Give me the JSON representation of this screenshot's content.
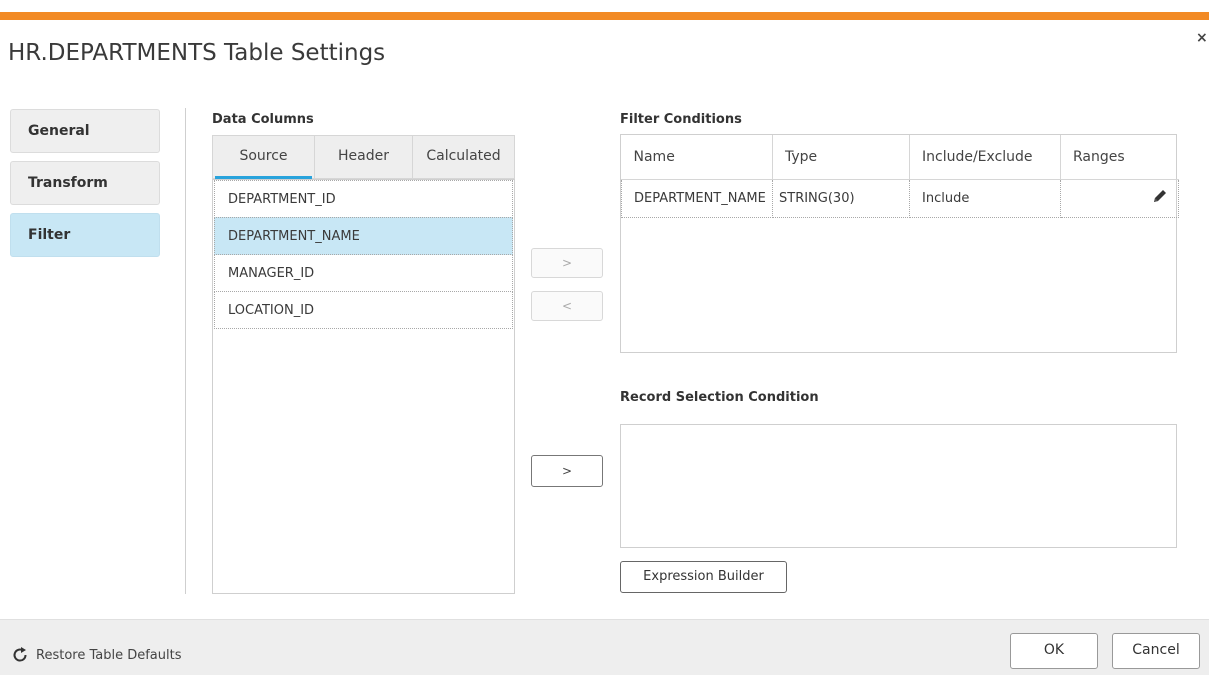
{
  "dialog": {
    "title": "HR.DEPARTMENTS Table Settings",
    "close_label": "×"
  },
  "colors": {
    "accent": "#f28a25",
    "selected": "#c8e7f5",
    "tab_underline": "#29a3dc"
  },
  "nav": {
    "items": [
      {
        "label": "General",
        "active": false
      },
      {
        "label": "Transform",
        "active": false
      },
      {
        "label": "Filter",
        "active": true
      }
    ]
  },
  "data_columns": {
    "title": "Data Columns",
    "tabs": [
      {
        "label": "Source",
        "active": true
      },
      {
        "label": "Header",
        "active": false
      },
      {
        "label": "Calculated",
        "active": false
      }
    ],
    "rows": [
      {
        "label": "DEPARTMENT_ID",
        "selected": false
      },
      {
        "label": "DEPARTMENT_NAME",
        "selected": true
      },
      {
        "label": "MANAGER_ID",
        "selected": false
      },
      {
        "label": "LOCATION_ID",
        "selected": false
      }
    ]
  },
  "transfer": {
    "add_label": ">",
    "remove_label": "<",
    "add_condition_label": ">"
  },
  "filter_conditions": {
    "title": "Filter Conditions",
    "headers": [
      "Name",
      "Type",
      "Include/Exclude",
      "Ranges"
    ],
    "rows": [
      {
        "name": "DEPARTMENT_NAME",
        "type": "STRING(30)",
        "include_exclude": "Include",
        "ranges": "",
        "ranges_icon": "pencil-icon"
      }
    ]
  },
  "record_selection": {
    "title": "Record Selection Condition",
    "value": ""
  },
  "expression_builder": {
    "label": "Expression Builder"
  },
  "footer": {
    "restore_label": "Restore Table Defaults",
    "restore_icon": "refresh-icon",
    "ok_label": "OK",
    "cancel_label": "Cancel"
  }
}
